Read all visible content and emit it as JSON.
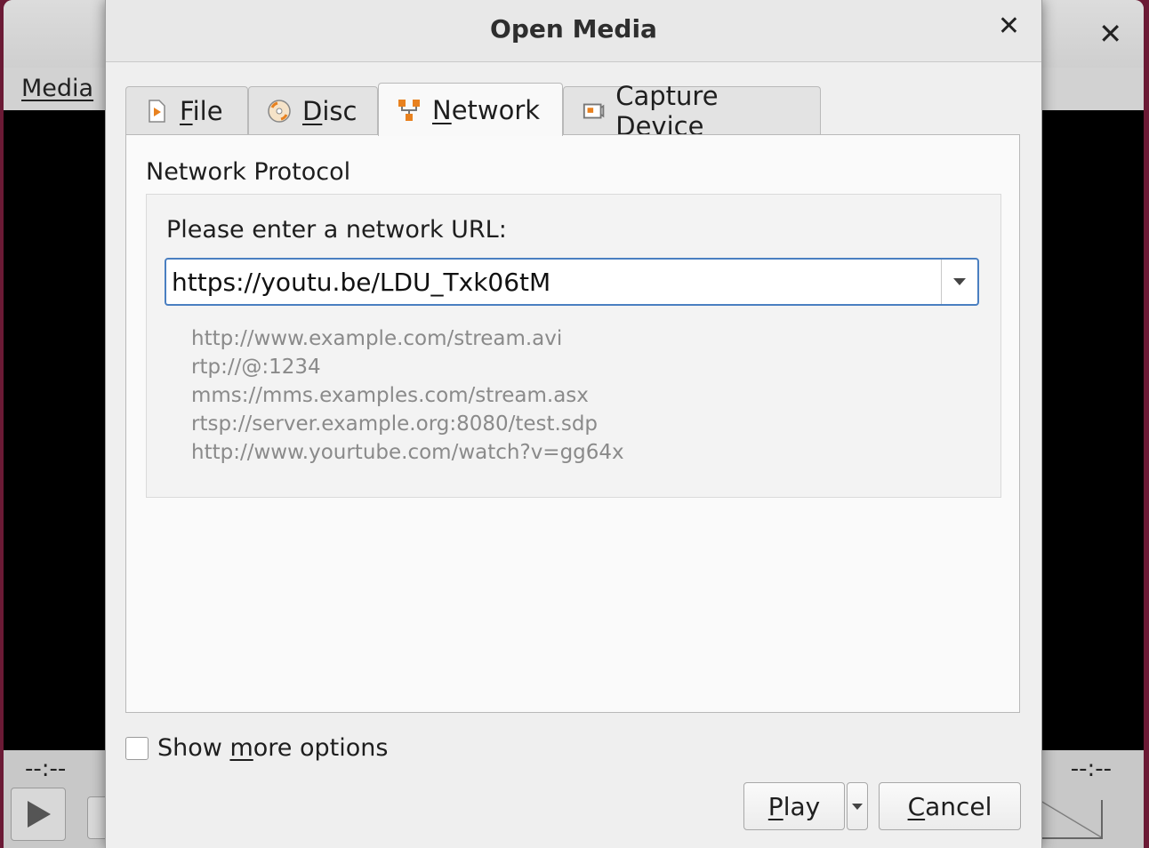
{
  "background_window": {
    "menu_media_label": "Media",
    "time_elapsed": "--:--",
    "time_total": "--:--",
    "close_glyph": "✕"
  },
  "dialog": {
    "title": "Open Media",
    "close_glyph": "✕",
    "tabs": [
      {
        "label_pre": "",
        "label_u": "F",
        "label_post": "ile",
        "icon": "file-icon",
        "active": false
      },
      {
        "label_pre": "",
        "label_u": "D",
        "label_post": "isc",
        "icon": "disc-icon",
        "active": false
      },
      {
        "label_pre": "",
        "label_u": "N",
        "label_post": "etwork",
        "icon": "network-icon",
        "active": true
      },
      {
        "label_pre": "Capture ",
        "label_u": "D",
        "label_post": "evice",
        "icon": "capture-device-icon",
        "active": false
      }
    ],
    "network": {
      "group_title": "Network Protocol",
      "url_label": "Please enter a network URL:",
      "url_value": "https://youtu.be/LDU_Txk06tM",
      "examples": [
        "http://www.example.com/stream.avi",
        "rtp://@:1234",
        "mms://mms.examples.com/stream.asx",
        "rtsp://server.example.org:8080/test.sdp",
        "http://www.yourtube.com/watch?v=gg64x"
      ]
    },
    "show_more_options": {
      "label_pre": "Show ",
      "label_u": "m",
      "label_post": "ore options",
      "checked": false
    },
    "buttons": {
      "play_u": "P",
      "play_post": "lay",
      "cancel_u": "C",
      "cancel_post": "ancel"
    }
  },
  "colors": {
    "focus_border": "#4a7fc1",
    "desktop_accent": "#6b1a35"
  }
}
